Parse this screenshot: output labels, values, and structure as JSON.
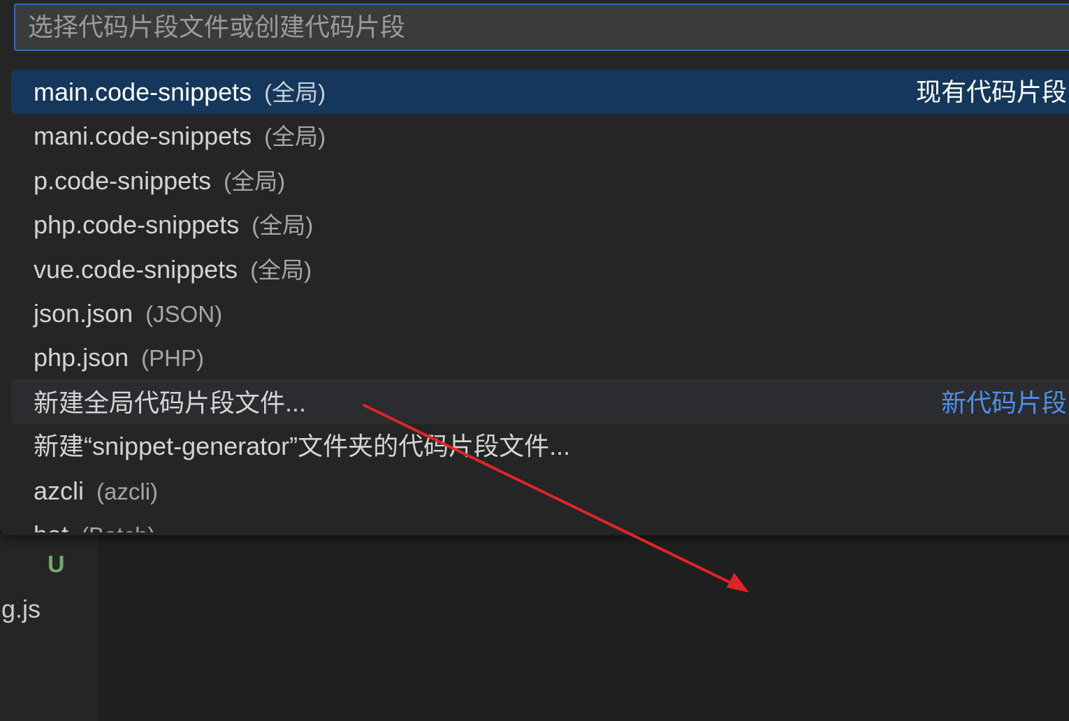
{
  "quick_pick": {
    "placeholder": "选择代码片段文件或创建代码片段",
    "items": [
      {
        "label": "main.code-snippets",
        "description": "(全局)",
        "separator": "现有代码片段"
      },
      {
        "label": "mani.code-snippets",
        "description": "(全局)"
      },
      {
        "label": "p.code-snippets",
        "description": "(全局)"
      },
      {
        "label": "php.code-snippets",
        "description": "(全局)"
      },
      {
        "label": "vue.code-snippets",
        "description": "(全局)"
      },
      {
        "label": "json.json",
        "description": "(JSON)"
      },
      {
        "label": "php.json",
        "description": "(PHP)"
      },
      {
        "label": "新建全局代码片段文件...",
        "description": "",
        "separator": "新代码片段"
      },
      {
        "label": "新建“snippet-generator”文件夹的代码片段文件...",
        "description": ""
      },
      {
        "label": "azcli",
        "description": "(azcli)"
      },
      {
        "label": "bat",
        "description": "(Batch)"
      }
    ]
  },
  "explorer": {
    "status_badge": "U",
    "file_name": "g.js"
  },
  "colors": {
    "selected_row": "#15375b",
    "separator_new": "#4b91ea",
    "annotation_arrow": "#e0242a"
  }
}
